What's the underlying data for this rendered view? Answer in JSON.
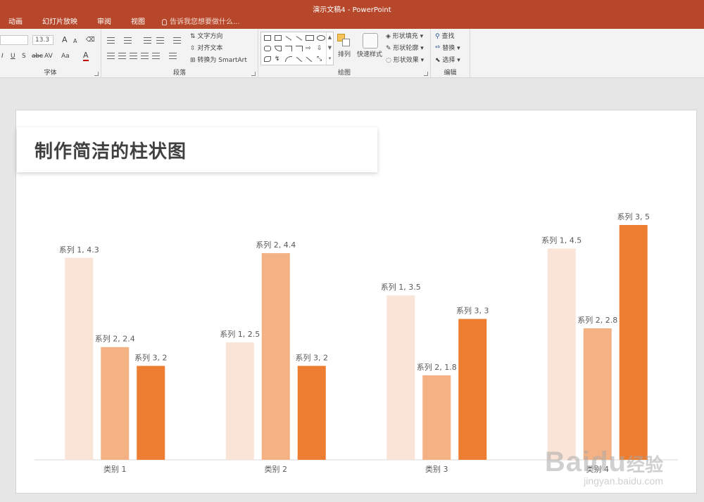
{
  "window": {
    "title": "演示文稿4 - PowerPoint"
  },
  "ribbon_tabs": [
    "动画",
    "幻灯片放映",
    "审阅",
    "视图"
  ],
  "tell_me": {
    "placeholder": "告诉我您想要做什么..."
  },
  "ribbon": {
    "font": {
      "font_size": "13.3",
      "bold": "I",
      "underline": "U",
      "shadow": "S",
      "strike": "abc",
      "spacing": "AV",
      "case": "Aa",
      "color": "A",
      "grow": "A",
      "shrink": "A",
      "label": "字体"
    },
    "paragraph": {
      "text_direction": "文字方向",
      "align_text": "对齐文本",
      "convert_smartart": "转换为 SmartArt",
      "label": "段落"
    },
    "drawing": {
      "arrange": "排列",
      "quick_styles": "快速样式",
      "shape_fill": "形状填充",
      "shape_outline": "形状轮廓",
      "shape_effects": "形状效果",
      "label": "绘图"
    },
    "editing": {
      "find": "查找",
      "replace": "替换",
      "select": "选择",
      "label": "编辑"
    }
  },
  "slide": {
    "title": "制作简洁的柱状图"
  },
  "chart_data": {
    "type": "bar",
    "categories": [
      "类别 1",
      "类别 2",
      "类别 3",
      "类别 4"
    ],
    "series": [
      {
        "name": "系列 1",
        "values": [
          4.3,
          2.5,
          3.5,
          4.5
        ],
        "color": "#fae4d7"
      },
      {
        "name": "系列 2",
        "values": [
          2.4,
          4.4,
          1.8,
          2.8
        ],
        "color": "#f4b183"
      },
      {
        "name": "系列 3",
        "values": [
          2,
          2,
          3,
          5
        ],
        "color": "#ed7d31"
      }
    ],
    "data_labels": [
      [
        "系列 1, 4.3",
        "系列 1, 2.5",
        "系列 1, 3.5",
        "系列 1, 4.5"
      ],
      [
        "系列 2, 2.4",
        "系列 2, 4.4",
        "系列 2, 1.8",
        "系列 2, 2.8"
      ],
      [
        "系列 3, 2",
        "系列 3, 2",
        "系列 3, 3",
        "系列 3, 5"
      ]
    ],
    "ylim": [
      0,
      5
    ],
    "grid": false,
    "legend": false
  },
  "watermark": {
    "logo": "Baidu",
    "cn": "经验",
    "url": "jingyan.baidu.com"
  }
}
